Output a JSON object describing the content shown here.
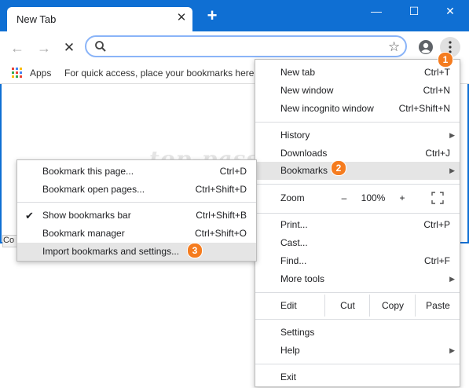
{
  "window": {
    "tab_title": "New Tab",
    "tab_close": "✕",
    "new_tab": "+",
    "minimize": "—",
    "maximize": "☐",
    "close": "✕"
  },
  "toolbar": {
    "back": "←",
    "forward": "→",
    "stop": "✕",
    "star": "☆"
  },
  "bookmarks_bar": {
    "apps_label": "Apps",
    "hint": "For quick access, place your bookmarks here o"
  },
  "status_text": "Co",
  "watermark": "top-password.com",
  "main_menu": {
    "new_tab": {
      "label": "New tab",
      "shortcut": "Ctrl+T"
    },
    "new_window": {
      "label": "New window",
      "shortcut": "Ctrl+N"
    },
    "new_incognito": {
      "label": "New incognito window",
      "shortcut": "Ctrl+Shift+N"
    },
    "history": {
      "label": "History"
    },
    "downloads": {
      "label": "Downloads",
      "shortcut": "Ctrl+J"
    },
    "bookmarks": {
      "label": "Bookmarks"
    },
    "zoom": {
      "label": "Zoom",
      "minus": "–",
      "value": "100%",
      "plus": "+"
    },
    "print": {
      "label": "Print...",
      "shortcut": "Ctrl+P"
    },
    "cast": {
      "label": "Cast..."
    },
    "find": {
      "label": "Find...",
      "shortcut": "Ctrl+F"
    },
    "more_tools": {
      "label": "More tools"
    },
    "edit": {
      "label": "Edit",
      "cut": "Cut",
      "copy": "Copy",
      "paste": "Paste"
    },
    "settings": {
      "label": "Settings"
    },
    "help": {
      "label": "Help"
    },
    "exit": {
      "label": "Exit"
    }
  },
  "bookmarks_submenu": {
    "bookmark_page": {
      "label": "Bookmark this page...",
      "shortcut": "Ctrl+D"
    },
    "bookmark_open_pages": {
      "label": "Bookmark open pages...",
      "shortcut": "Ctrl+Shift+D"
    },
    "show_bar": {
      "label": "Show bookmarks bar",
      "shortcut": "Ctrl+Shift+B",
      "checked": true
    },
    "manager": {
      "label": "Bookmark manager",
      "shortcut": "Ctrl+Shift+O"
    },
    "import": {
      "label": "Import bookmarks and settings..."
    }
  },
  "badges": [
    "1",
    "2",
    "3"
  ],
  "colors": {
    "titlebar": "#0f6fd3",
    "badge": "#f57c1f",
    "highlight": "#e5e5e5"
  }
}
